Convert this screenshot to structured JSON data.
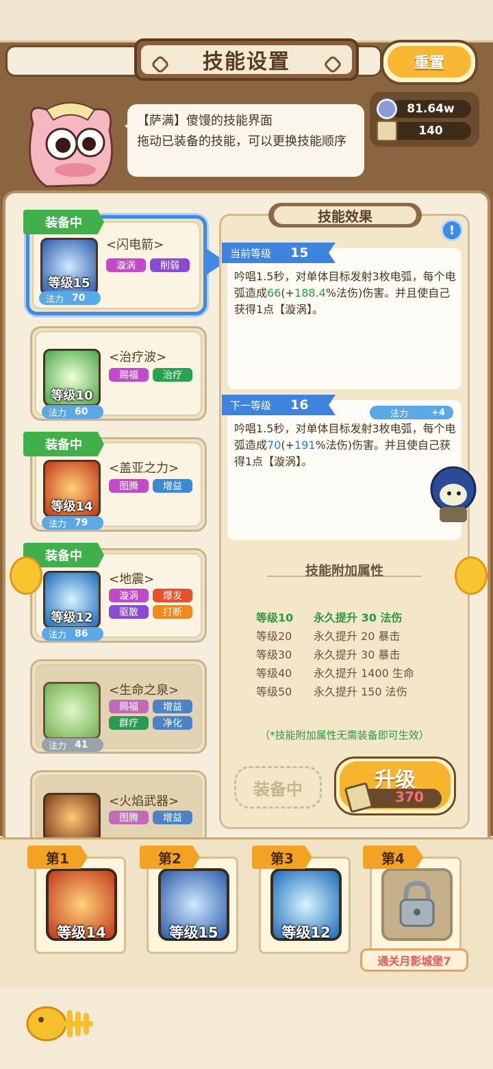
{
  "header": {
    "title": "技能设置",
    "reset_label": "重置"
  },
  "npc": {
    "speech_line1": "【萨满】傻馒的技能界面",
    "speech_line2": "拖动已装备的技能，可以更换技能顺序"
  },
  "resources": {
    "coins": "81.64w",
    "scrolls": "140"
  },
  "skills": [
    {
      "name": "<闪电箭>",
      "level": "等级15",
      "mp_label": "法力",
      "mp": "70",
      "equipped": "装备中",
      "tags": [
        {
          "t": "漩涡",
          "c": "#c04ac8"
        },
        {
          "t": "削弱",
          "c": "#8a4ad6"
        }
      ]
    },
    {
      "name": "<治疗波>",
      "level": "等级10",
      "mp_label": "法力",
      "mp": "60",
      "tags": [
        {
          "t": "赐福",
          "c": "#c04ac8"
        },
        {
          "t": "治疗",
          "c": "#2aa350"
        }
      ]
    },
    {
      "name": "<盖亚之力>",
      "level": "等级14",
      "mp_label": "法力",
      "mp": "79",
      "equipped": "装备中",
      "tags": [
        {
          "t": "图腾",
          "c": "#c04ac8"
        },
        {
          "t": "增益",
          "c": "#3a8ad6"
        }
      ]
    },
    {
      "name": "<地震>",
      "level": "等级12",
      "mp_label": "法力",
      "mp": "86",
      "equipped": "装备中",
      "tags": [
        {
          "t": "漩涡",
          "c": "#c04ac8"
        },
        {
          "t": "爆发",
          "c": "#e8502c"
        },
        {
          "t": "驱散",
          "c": "#8a4ad6"
        },
        {
          "t": "打断",
          "c": "#f08a1c"
        }
      ]
    },
    {
      "name": "<生命之泉>",
      "mp_label": "法力",
      "mp": "41",
      "tags": [
        {
          "t": "赐福",
          "c": "#c06ab8"
        },
        {
          "t": "增益",
          "c": "#4a84c6"
        },
        {
          "t": "群疗",
          "c": "#2a9a50"
        },
        {
          "t": "净化",
          "c": "#4a84c6"
        }
      ]
    },
    {
      "name": "<火焰武器>",
      "tags": [
        {
          "t": "图腾",
          "c": "#c06ab8"
        },
        {
          "t": "增益",
          "c": "#4a84c6"
        }
      ]
    }
  ],
  "effect": {
    "title": "技能效果",
    "current_label": "当前等级",
    "current_level": "15",
    "current_desc_a": "吟唱1.5秒，对单体目标发射3枚电弧，每个电弧造成",
    "current_dmg": "66",
    "current_ratio_pre": "(+",
    "current_ratio": "188.4",
    "current_desc_b": "%法伤)伤害。并且使自己获得1点【漩涡】。",
    "next_label": "下一等级",
    "next_level": "16",
    "next_mp_label": "法力",
    "next_mp_delta": "+4",
    "next_desc_a": "吟唱1.5秒，对单体目标发射3枚电弧，每个电弧造成",
    "next_dmg": "70",
    "next_ratio_pre": "(+",
    "next_ratio": "191",
    "next_desc_b": "%法伤)伤害。并且使自己获得1点【漩涡】。",
    "attr_title": "技能附加属性",
    "attrs": [
      {
        "lv": "等级10",
        "bonus": "永久提升 30 法伤"
      },
      {
        "lv": "等级20",
        "bonus": "永久提升 20 暴击"
      },
      {
        "lv": "等级30",
        "bonus": "永久提升 30 暴击"
      },
      {
        "lv": "等级40",
        "bonus": "永久提升 1400 生命"
      },
      {
        "lv": "等级50",
        "bonus": "永久提升 150 法伤"
      }
    ],
    "attr_note": "（*技能附加属性无需装备即可生效）",
    "equip_btn": "装备中",
    "upgrade_label": "升级",
    "upgrade_cost": "370"
  },
  "slots": [
    {
      "tag": "第1",
      "level": "等级14"
    },
    {
      "tag": "第2",
      "level": "等级15"
    },
    {
      "tag": "第3",
      "level": "等级12"
    },
    {
      "tag": "第4",
      "unlock": "通关月影城堡7"
    }
  ],
  "colors": {
    "accent": "#f6b42f",
    "selected": "#3e8ae6",
    "equipped": "#3fb04a"
  }
}
